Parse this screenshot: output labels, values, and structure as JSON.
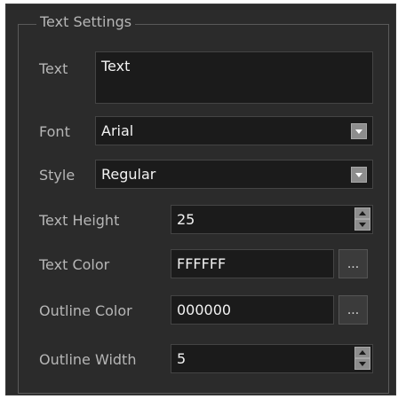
{
  "group": {
    "title": "Text Settings"
  },
  "text": {
    "label": "Text",
    "value": "Text"
  },
  "font": {
    "label": "Font",
    "value": "Arial"
  },
  "style": {
    "label": "Style",
    "value": "Regular"
  },
  "text_height": {
    "label": "Text Height",
    "value": "25"
  },
  "text_color": {
    "label": "Text Color",
    "value": "FFFFFF",
    "button_label": "..."
  },
  "outline_color": {
    "label": "Outline Color",
    "value": "000000",
    "button_label": "..."
  },
  "outline_width": {
    "label": "Outline Width",
    "value": "5"
  },
  "icons": {
    "combo_dropdown": "chevron-down-icon",
    "spin_up": "chevron-up-icon",
    "spin_down": "chevron-down-icon"
  },
  "colors": {
    "panel_background": "#2b2b2b",
    "field_background": "#1b1b1b",
    "label_text": "#b6b6b6",
    "value_text": "#f2f2f2",
    "button_face": "#8d8d8d"
  }
}
